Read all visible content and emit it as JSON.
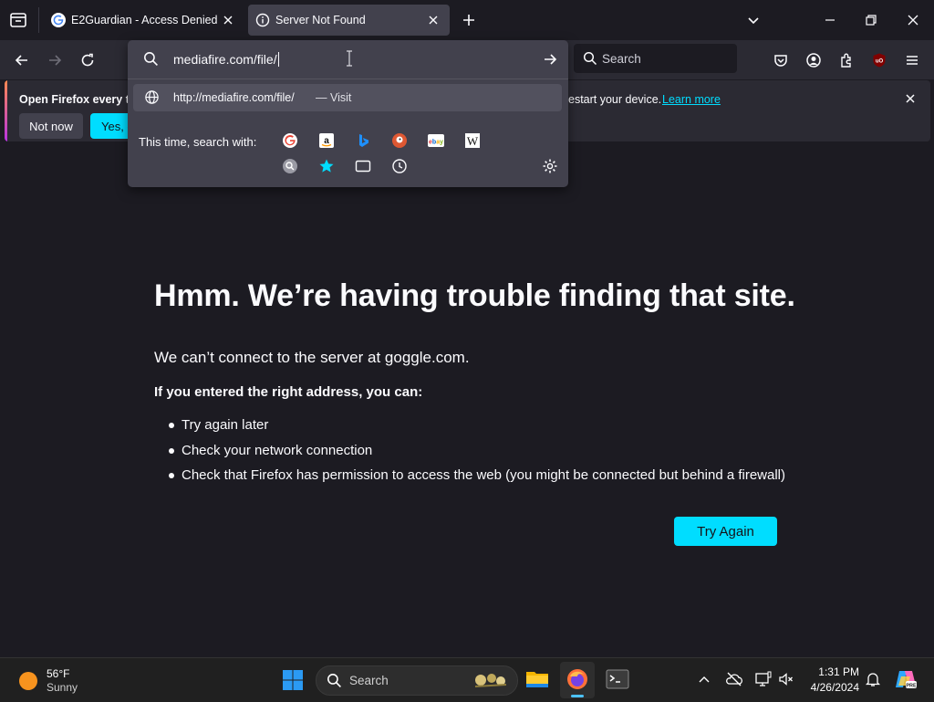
{
  "tabs": [
    {
      "title": "E2Guardian - Access Denied",
      "icon": "google-g-icon",
      "active": false
    },
    {
      "title": "Server Not Found",
      "icon": "info-icon",
      "active": true
    }
  ],
  "urlbar": {
    "value": "mediafire.com/file/",
    "result_url": "http://mediafire.com/file/",
    "result_action": "— Visit",
    "search_with_label": "This time, search with:",
    "engines": [
      "Google",
      "Amazon",
      "Bing",
      "DuckDuckGo",
      "eBay",
      "Wikipedia"
    ],
    "modes": [
      "history-search",
      "bookmarks",
      "tabs",
      "history"
    ]
  },
  "toolbar": {
    "search_placeholder": "Search"
  },
  "notification": {
    "text_left": "Open Firefox every ti",
    "text_right": "estart your device.",
    "learn_more": "Learn more",
    "not_now": "Not now",
    "yes_button": "Yes, c"
  },
  "error_page": {
    "title": "Hmm. We’re having trouble finding that site.",
    "message": "We can’t connect to the server at goggle.com.",
    "suggestion_heading": "If you entered the right address, you can:",
    "suggestions": [
      "Try again later",
      "Check your network connection",
      "Check that Firefox has permission to access the web (you might be connected but behind a firewall)"
    ],
    "try_again": "Try Again"
  },
  "taskbar": {
    "weather_temp": "56°F",
    "weather_desc": "Sunny",
    "search_placeholder": "Search",
    "time": "1:31 PM",
    "date": "4/26/2024",
    "colors": {
      "accent": "#00ddff",
      "background": "#202020"
    }
  }
}
